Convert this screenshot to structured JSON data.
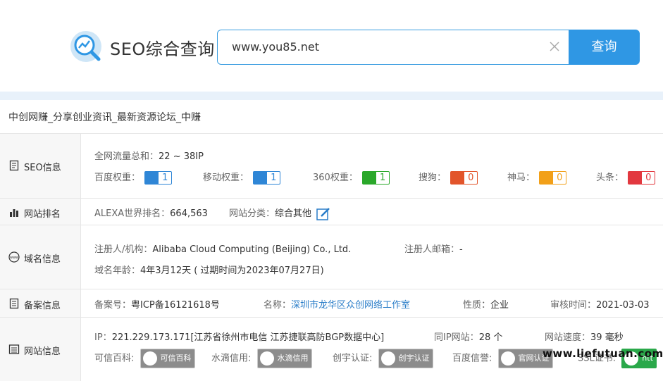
{
  "header": {
    "brand": "SEO综合查询",
    "search_value": "www.you85.net",
    "search_button": "查询"
  },
  "site_title": "中创网赚_分享创业资讯_最新资源论坛_中赚",
  "seo": {
    "label": "SEO信息",
    "traffic_label": "全网流量总和：",
    "traffic_value": "22 ~ 38IP",
    "weights": [
      {
        "label": "百度权重：",
        "value": "1",
        "color": "#2f86d6"
      },
      {
        "label": "移动权重：",
        "value": "1",
        "color": "#2f86d6"
      },
      {
        "label": "360权重：",
        "value": "1",
        "color": "#2aa82a"
      },
      {
        "label": "搜狗：",
        "value": "0",
        "color": "#e2552b"
      },
      {
        "label": "神马：",
        "value": "0",
        "color": "#f2a019"
      },
      {
        "label": "头条：",
        "value": "0",
        "color": "#e2383f"
      }
    ]
  },
  "rank": {
    "label": "网站排名",
    "alexa_label": "ALEXA世界排名：",
    "alexa_value": "664,563",
    "category_label": "网站分类：",
    "category_value": "综合其他"
  },
  "domain": {
    "label": "域名信息",
    "registrant_label": "注册人/机构：",
    "registrant_value": "Alibaba Cloud Computing (Beijing) Co., Ltd.",
    "email_label": "注册人邮箱：",
    "email_value": "-",
    "age_label": "域名年龄：",
    "age_value": "4年3月12天 ( 过期时间为2023年07月27日)"
  },
  "icp": {
    "label": "备案信息",
    "number_label": "备案号：",
    "number_value": "粤ICP备16121618号",
    "name_label": "名称：",
    "name_value": "深圳市龙华区众创网络工作室",
    "type_label": "性质：",
    "type_value": "企业",
    "date_label": "审核时间：",
    "date_value": "2021-03-03"
  },
  "siteinfo": {
    "label": "网站信息",
    "ip_label": "IP：",
    "ip_value": "221.229.173.171[江苏省徐州市电信 江苏捷联高防BGP数据中心]",
    "same_ip_label": "同IP网站：",
    "same_ip_value": "28 个",
    "speed_label": "网站速度：",
    "speed_value": "39 毫秒",
    "certs": [
      {
        "label": "可信百科:",
        "badge": "可信百科"
      },
      {
        "label": "水滴信用:",
        "badge": "水滴信用"
      },
      {
        "label": "创宇认证:",
        "badge": "创宇认证"
      },
      {
        "label": "百度信誉:",
        "badge": "官网认证"
      },
      {
        "label": "SSL证书:",
        "badge": "htt"
      }
    ]
  },
  "watermark": "www.liefutuan.com"
}
